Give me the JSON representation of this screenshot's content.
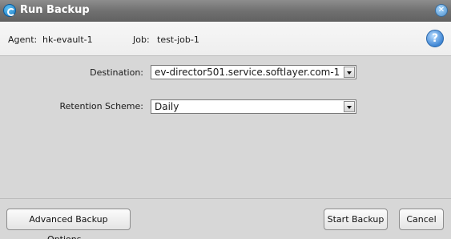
{
  "window": {
    "title": "Run Backup"
  },
  "info": {
    "agent_label": "Agent:",
    "agent_value": "hk-evault-1",
    "job_label": "Job:",
    "job_value": "test-job-1"
  },
  "form": {
    "destination_label": "Destination:",
    "destination_value": "ev-director501.service.softlayer.com-1",
    "retention_label": "Retention Scheme:",
    "retention_value": "Daily"
  },
  "footer": {
    "advanced_label": "Advanced Backup Options...",
    "start_label": "Start Backup",
    "cancel_label": "Cancel"
  },
  "icons": {
    "app": "evault-logo-icon",
    "close": "close-icon",
    "help": "help-icon",
    "dropdown": "chevron-down-icon"
  }
}
